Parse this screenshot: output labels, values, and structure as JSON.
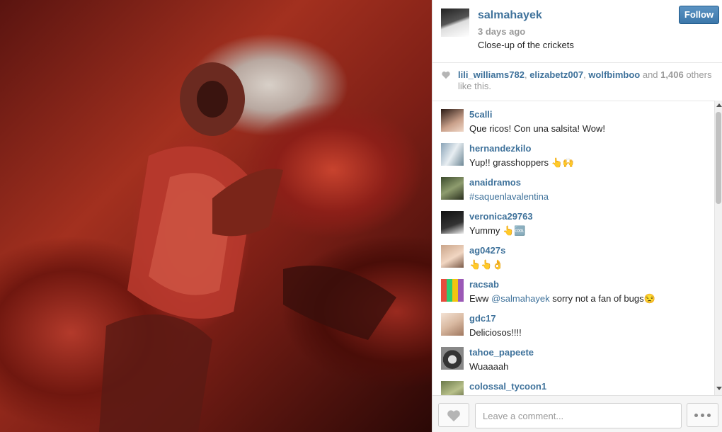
{
  "post": {
    "username": "salmahayek",
    "time": "3 days ago",
    "caption": "Close-up of the crickets",
    "follow_label": "Follow"
  },
  "likes": {
    "users": [
      "lili_williams782",
      "elizabetz007",
      "wolfbimboo"
    ],
    "sep1": ", ",
    "sep2": ", ",
    "and_text": " and ",
    "count": "1,406",
    "suffix": " others like this."
  },
  "comments": [
    {
      "user": "5calli",
      "text": "Que ricos! Con una salsita! Wow!"
    },
    {
      "user": "hernandezkilo",
      "text": "Yup!! grasshoppers 👆🙌"
    },
    {
      "user": "anaidramos",
      "text": "#saquenlavalentina"
    },
    {
      "user": "veronica29763",
      "text": "Yummy 👆🆒"
    },
    {
      "user": "ag0427s",
      "text": "👆👆👌"
    },
    {
      "user": "racsab",
      "text_pre": "Eww ",
      "mention": "@salmahayek",
      "text_post": " sorry not a fan of bugs😒"
    },
    {
      "user": "gdc17",
      "text": "Deliciosos!!!!"
    },
    {
      "user": "tahoe_papeete",
      "text": "Wuaaaah"
    },
    {
      "user": "colossal_tycoon1",
      "text": ""
    }
  ],
  "comment_box": {
    "placeholder": "Leave a comment..."
  },
  "icons": {
    "like": "heart-icon",
    "more": "more-options-icon"
  }
}
